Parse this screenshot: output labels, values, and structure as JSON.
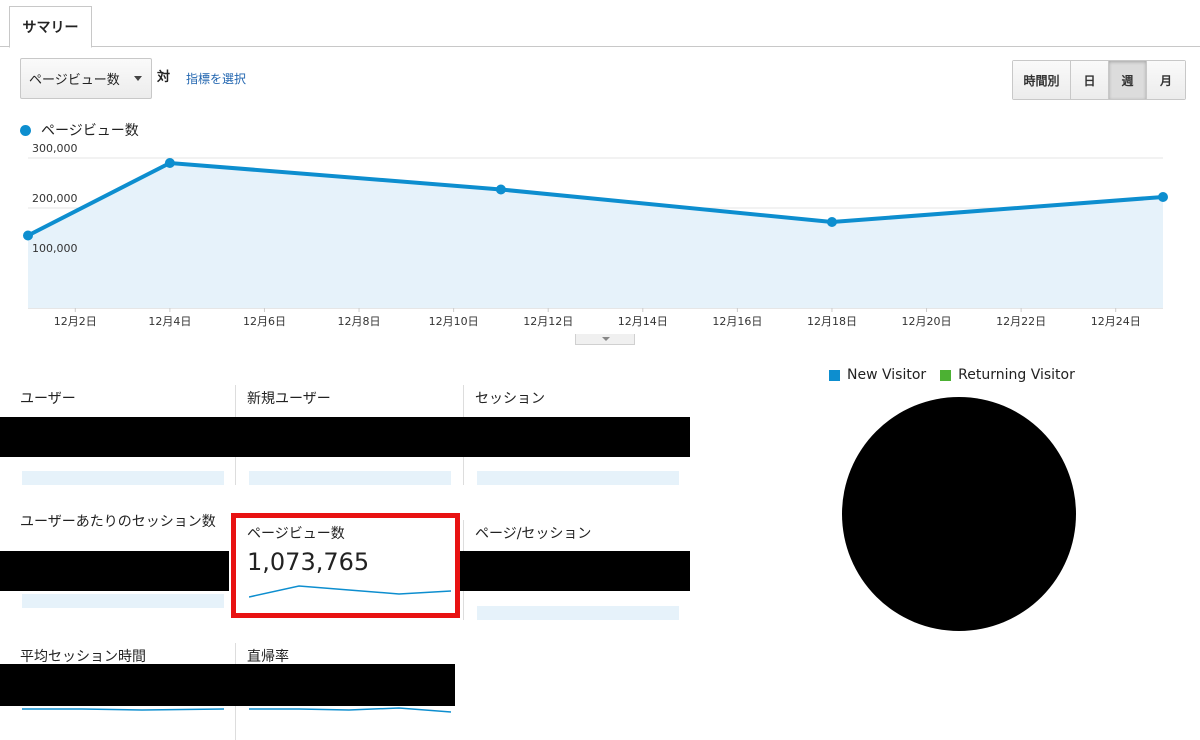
{
  "tabs": [
    {
      "label": "サマリー"
    }
  ],
  "toolbar": {
    "metric_select_value": "ページビュー数",
    "vs_label": "対",
    "select_metric_link": "指標を選択",
    "ranges": [
      {
        "label": "時間別",
        "active": false
      },
      {
        "label": "日",
        "active": false
      },
      {
        "label": "週",
        "active": true
      },
      {
        "label": "月",
        "active": false
      }
    ]
  },
  "chart_legend": {
    "label": "ページビュー数",
    "color": "#0d8ecf"
  },
  "chart_data": {
    "type": "area",
    "series": [
      {
        "name": "ページビュー数",
        "values": [
          {
            "x": "12月1日",
            "y": 145000
          },
          {
            "x": "12月4日",
            "y": 290000
          },
          {
            "x": "12月11日",
            "y": 237000
          },
          {
            "x": "12月18日",
            "y": 172000
          },
          {
            "x": "12月25日",
            "y": 222000
          }
        ]
      }
    ],
    "x_ticks": [
      "12月2日",
      "12月4日",
      "12月6日",
      "12月8日",
      "12月10日",
      "12月12日",
      "12月14日",
      "12月16日",
      "12月18日",
      "12月20日",
      "12月22日",
      "12月24日"
    ],
    "y_ticks": [
      {
        "value": 100000,
        "label": "100,000"
      },
      {
        "value": 200000,
        "label": "200,000"
      },
      {
        "value": 300000,
        "label": "300,000"
      }
    ],
    "ylim": [
      0,
      300000
    ],
    "x_start_day": 1,
    "x_end_day": 25,
    "grid": true,
    "line_color": "#0d8ecf",
    "fill_color": "#e6f2fa"
  },
  "metrics": [
    {
      "name": "ユーザー"
    },
    {
      "name": "新規ユーザー"
    },
    {
      "name": "セッション"
    },
    {
      "name": "ユーザーあたりのセッション数"
    },
    {
      "name": "ページビュー数",
      "value": "1,073,765"
    },
    {
      "name": "ページ/セッション"
    },
    {
      "name": "平均セッション時間"
    },
    {
      "name": "直帰率"
    }
  ],
  "pie_legend": [
    {
      "label": "New Visitor",
      "color": "#0d8ecf"
    },
    {
      "label": "Returning Visitor",
      "color": "#4cb133"
    }
  ],
  "colors": {
    "accent": "#0d8ecf",
    "highlight": "#e81212",
    "link": "#2266b0"
  }
}
